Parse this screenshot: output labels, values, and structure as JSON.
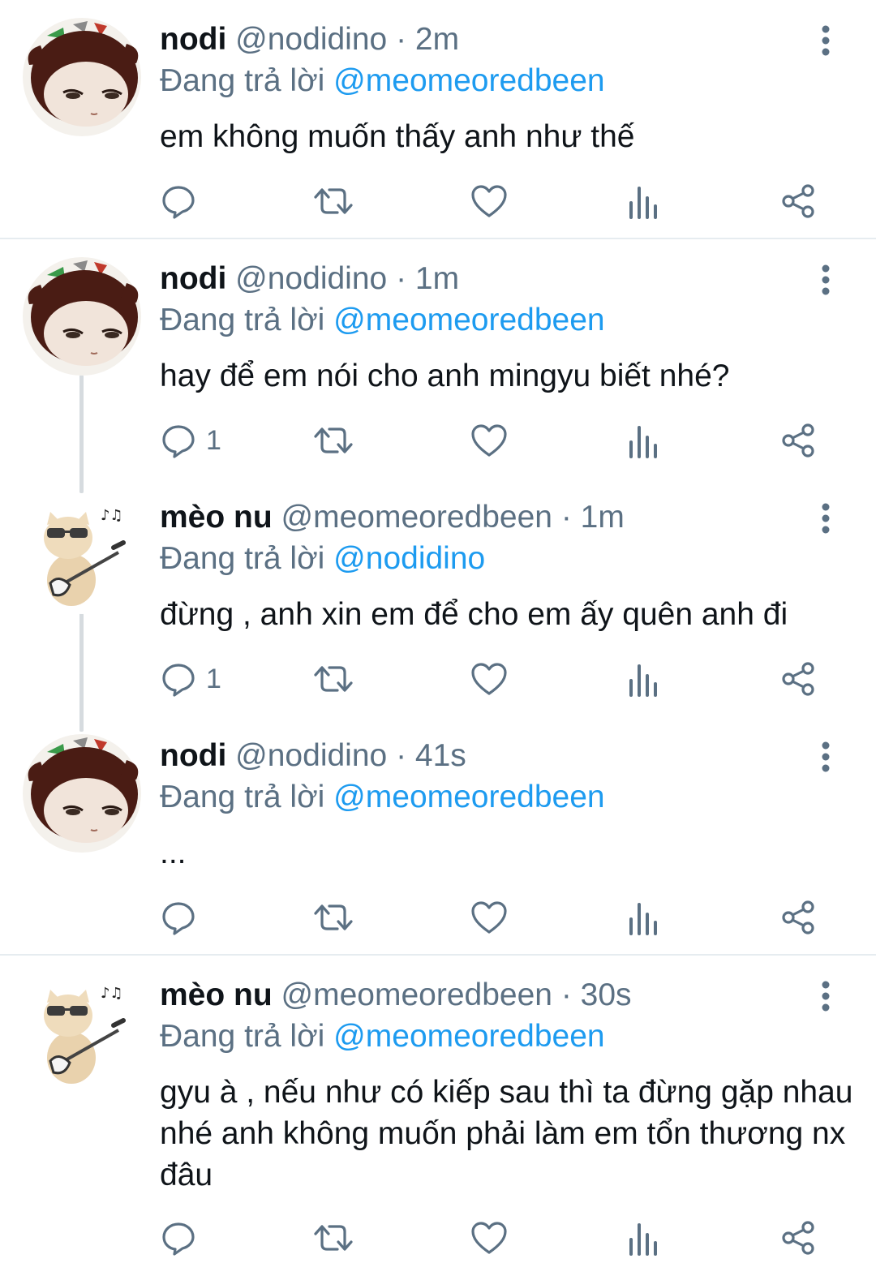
{
  "colors": {
    "accent": "#1d9bf0",
    "secondary_text": "#5b7083",
    "primary_text": "#0f1419",
    "divider": "#e6ecf0"
  },
  "icons": [
    "more-vertical-icon",
    "reply-icon",
    "retweet-icon",
    "like-icon",
    "views-icon",
    "share-icon"
  ],
  "tweets": [
    {
      "name": "nodi",
      "handle": "@nodidino",
      "sep": "·",
      "time": "2m",
      "reply_label": "Đang trả lời",
      "reply_to": "@meomeoredbeen",
      "text": "em không muốn thấy anh như thế",
      "reply_count": ""
    },
    {
      "name": "nodi",
      "handle": "@nodidino",
      "sep": "·",
      "time": "1m",
      "reply_label": "Đang trả lời",
      "reply_to": "@meomeoredbeen",
      "text": "hay để em nói cho anh mingyu biết nhé?",
      "reply_count": "1"
    },
    {
      "name": "mèo nu",
      "handle": "@meomeoredbeen",
      "sep": "·",
      "time": "1m",
      "reply_label": "Đang trả lời",
      "reply_to": "@nodidino",
      "text": "đừng , anh xin em để cho em ấy quên anh đi",
      "reply_count": "1"
    },
    {
      "name": "nodi",
      "handle": "@nodidino",
      "sep": "·",
      "time": "41s",
      "reply_label": "Đang trả lời",
      "reply_to": "@meomeoredbeen",
      "text": "...",
      "reply_count": ""
    },
    {
      "name": "mèo nu",
      "handle": "@meomeoredbeen",
      "sep": "·",
      "time": "30s",
      "reply_label": "Đang trả lời",
      "reply_to": "@meomeoredbeen",
      "text": "gyu à , nếu như có kiếp sau thì ta đừng gặp nhau nhé anh không muốn phải làm em tổn thương nx đâu",
      "reply_count": ""
    }
  ]
}
